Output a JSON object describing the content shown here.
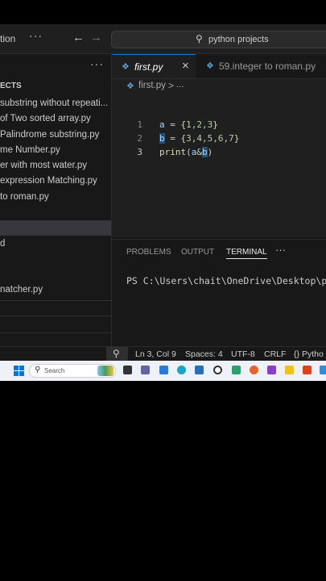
{
  "titlebar": {
    "left_text": "tion",
    "more_label": "···",
    "search_text": "python projects"
  },
  "sidebar": {
    "more_label": "···",
    "header": "ECTS",
    "files": [
      "substring without repeati...",
      "of Two sorted array.py",
      " Palindrome substring.py",
      "me Number.py",
      "er with most water.py",
      "expression Matching.py",
      "to roman.py"
    ],
    "other_items": [
      "d",
      "natcher.py"
    ]
  },
  "editor": {
    "tabs": [
      {
        "label": "first.py",
        "active": true
      },
      {
        "label": "59.integer to roman.py",
        "active": false
      }
    ],
    "breadcrumb": {
      "file": "first.py",
      "sep": ">",
      "more": "..."
    },
    "lines": [
      {
        "num": "1",
        "var": "a",
        "eq": " = ",
        "open": "{",
        "items": "1,2,3",
        "close": "}"
      },
      {
        "num": "2",
        "var": "b",
        "eq": " = ",
        "open": "{",
        "items": "3,4,5,6,7",
        "close": "}"
      },
      {
        "num": "3",
        "func": "print",
        "args_open": "(",
        "arg_a": "a",
        "op": "&",
        "arg_b": "b",
        "args_close": ")"
      }
    ]
  },
  "panel": {
    "tabs": [
      "PROBLEMS",
      "OUTPUT",
      "TERMINAL"
    ],
    "active_tab": "TERMINAL",
    "more_label": "···",
    "terminal_line": "PS C:\\Users\\chait\\OneDrive\\Desktop\\pyth"
  },
  "statusbar": {
    "position": "Ln 3, Col 9",
    "spaces": "Spaces: 4",
    "encoding": "UTF-8",
    "eol": "CRLF",
    "language": "Pytho"
  },
  "taskbar": {
    "search_text": "Search"
  },
  "colors": {
    "accent": "#0078d4",
    "editor_bg": "#1f1f1f",
    "sidebar_bg": "#181818",
    "selection": "#264f78",
    "taskbar_bg": "#eef1f7"
  }
}
